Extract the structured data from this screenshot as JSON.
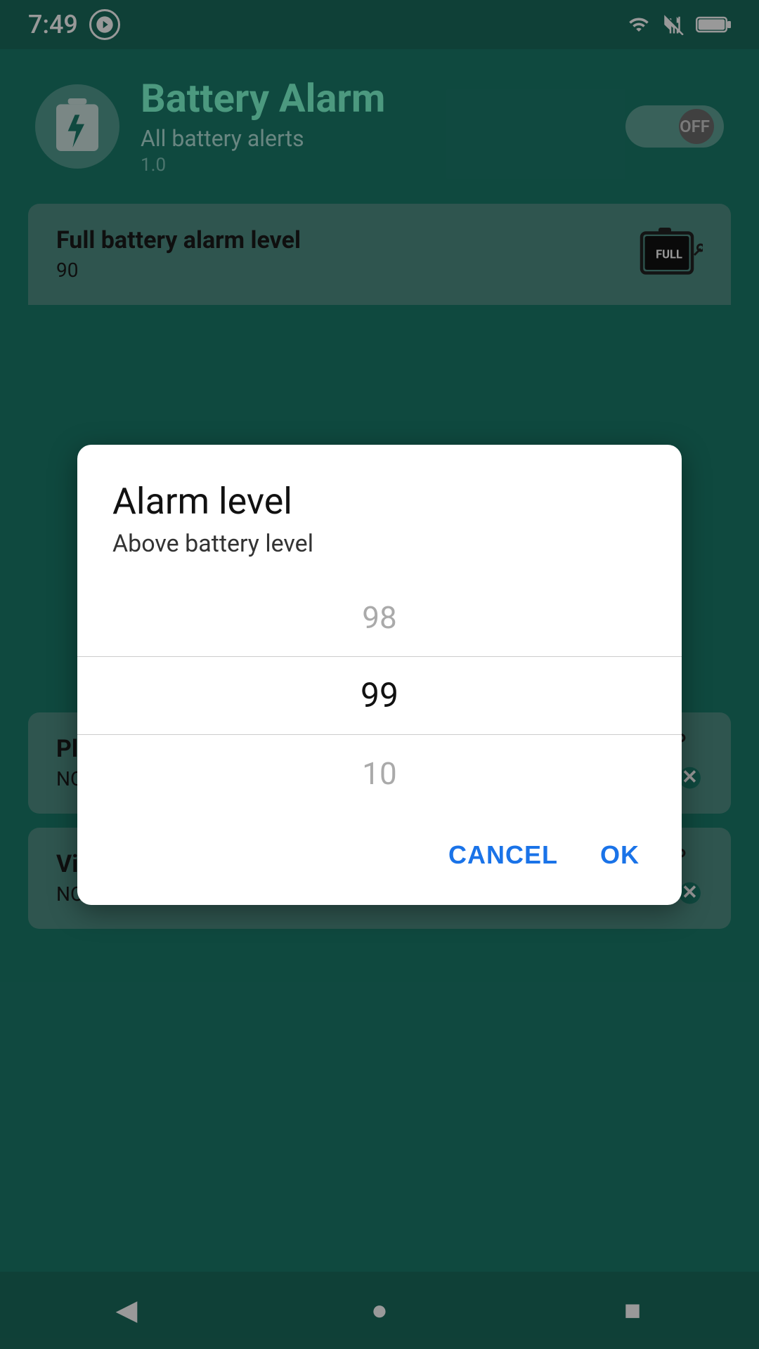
{
  "statusBar": {
    "time": "7:49",
    "icons": [
      "wifi",
      "signal",
      "battery"
    ]
  },
  "header": {
    "appTitle": "Battery Alarm",
    "appSubtitle": "All battery alerts",
    "appVersion": "1.0",
    "toggleState": "OFF"
  },
  "cards": [
    {
      "id": "full-battery-alarm",
      "title": "Full battery alarm level",
      "value": "90"
    },
    {
      "id": "play-alarm-tone",
      "title": "Play alarm tone, ignore silent mode",
      "value": "NO"
    },
    {
      "id": "vibrate-alarm",
      "title": "Vibrate with alarm",
      "value": "NO"
    }
  ],
  "dialog": {
    "title": "Alarm level",
    "subtitle": "Above battery level",
    "pickerItems": [
      "98",
      "99",
      "10"
    ],
    "selectedIndex": 1,
    "cancelLabel": "CANCEL",
    "okLabel": "OK"
  },
  "bottomNav": {
    "backLabel": "◀",
    "homeLabel": "●",
    "recentLabel": "■"
  }
}
